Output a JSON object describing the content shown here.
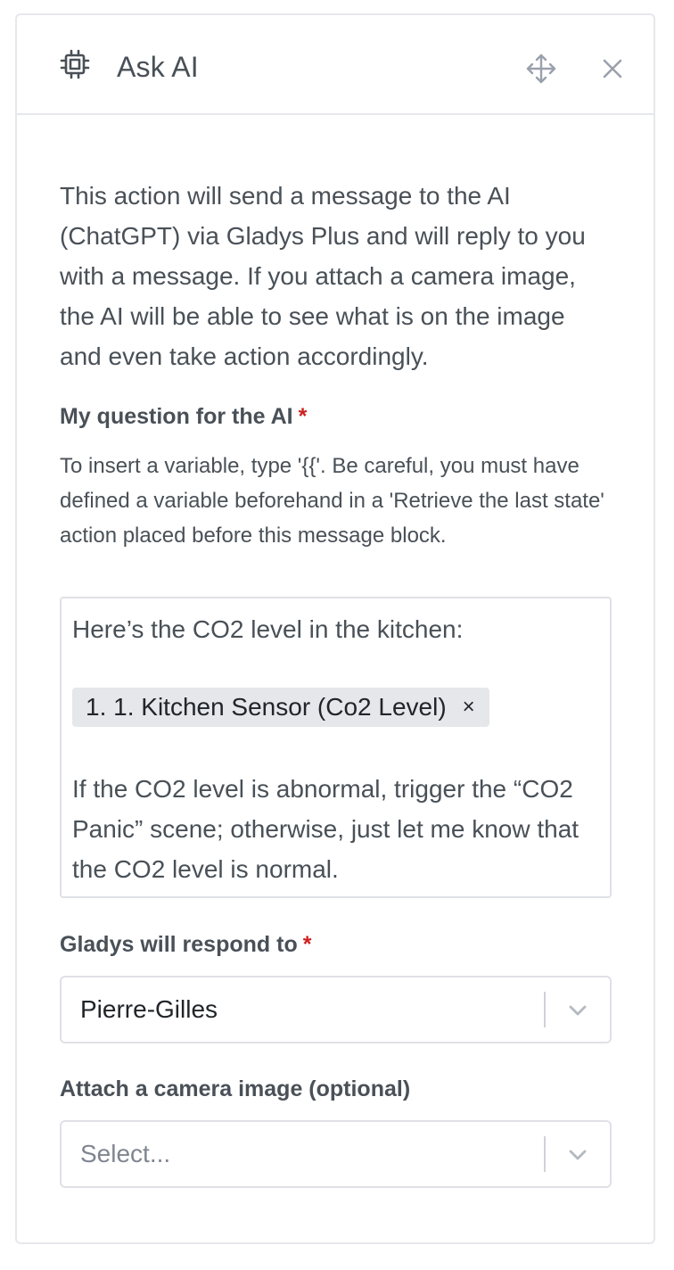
{
  "header": {
    "title": "Ask AI",
    "icon": "cpu-chip-icon",
    "move_icon": "move-arrows-icon",
    "close_icon": "close-x-icon"
  },
  "description": "This action will send a message to the AI (ChatGPT) via Gladys Plus and will reply to you with a message. If you attach a camera image, the AI will be able to see what is on the image and even take action accordingly.",
  "question": {
    "label": "My question for the AI",
    "required_marker": "*",
    "hint": "To insert a variable, type '{{'. Be careful, you must have defined a variable beforehand in a 'Retrieve the last state' action placed before this message block.",
    "line1": "Here’s the CO2 level in the kitchen:",
    "tag_label": "1. 1. Kitchen Sensor (Co2 Level)",
    "tag_remove": "×",
    "paragraph": "If the CO2 level is abnormal, trigger the “CO2 Panic” scene; otherwise, just let me know that the CO2 level is normal."
  },
  "respond_to": {
    "label": "Gladys will respond to",
    "required_marker": "*",
    "value": "Pierre-Gilles"
  },
  "camera": {
    "label": "Attach a camera image (optional)",
    "placeholder": "Select..."
  },
  "colors": {
    "text": "#495057",
    "required": "#cd201f",
    "border": "#dfe1e6",
    "tag_bg": "#e5e7ea",
    "icon_muted": "#9aa0ac"
  }
}
